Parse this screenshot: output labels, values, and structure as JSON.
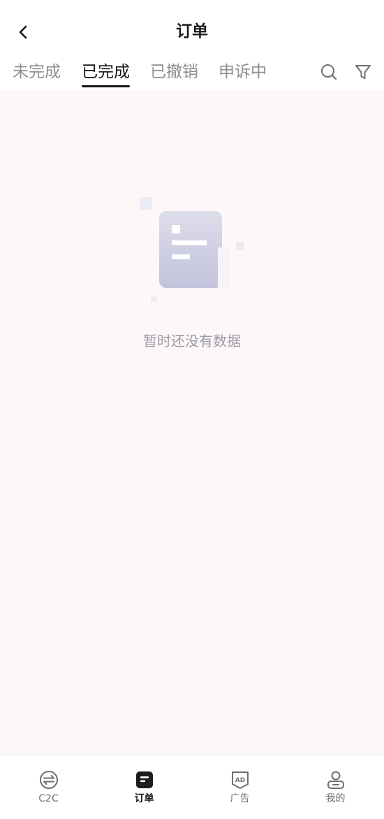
{
  "header": {
    "title": "订单"
  },
  "tabs": [
    {
      "label": "未完成"
    },
    {
      "label": "已完成"
    },
    {
      "label": "已撤销"
    },
    {
      "label": "申诉中"
    }
  ],
  "active_tab": "已完成",
  "icons": {
    "back": "chevron-left-icon",
    "search": "search-icon",
    "filter": "filter-icon",
    "empty": "empty-document-icon"
  },
  "empty_state": {
    "message": "暂时还没有数据"
  },
  "bottom_nav": [
    {
      "label": "C2C",
      "icon": "c2c-exchange-icon"
    },
    {
      "label": "订单",
      "icon": "orders-icon"
    },
    {
      "label": "广告",
      "icon": "ad-icon"
    },
    {
      "label": "我的",
      "icon": "profile-icon"
    }
  ],
  "active_nav": "订单",
  "colors": {
    "background": "#fdf7f9",
    "text_primary": "#141414",
    "text_secondary": "#8d8d93",
    "illustration": "#c9c9e0"
  }
}
